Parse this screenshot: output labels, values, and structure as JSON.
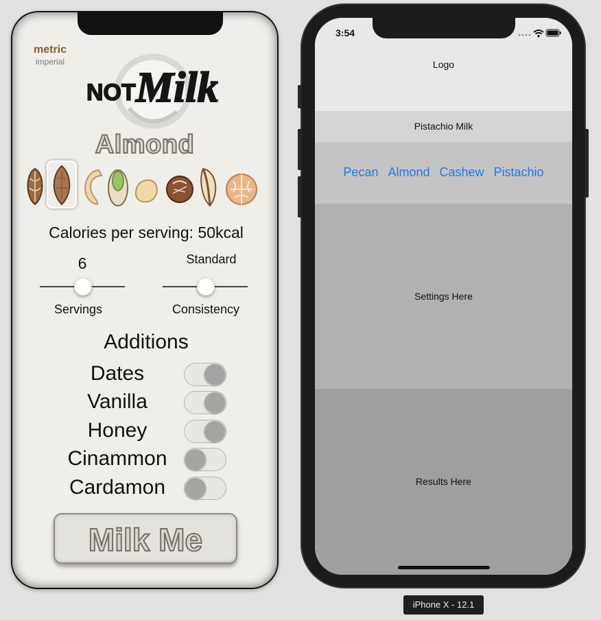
{
  "left_app": {
    "units": {
      "selected": "metric",
      "other": "imperial"
    },
    "brand": {
      "logo_alt": "NotMilk",
      "logo_text_part1": "NOT",
      "logo_text_part2": "Milk"
    },
    "selected_nut": "Almond",
    "nut_icons": [
      "pecan-icon",
      "almond-icon",
      "cashew-icon",
      "pistachio-icon",
      "macadamia-icon",
      "hazelnut-icon",
      "brazil-nut-icon",
      "walnut-icon"
    ],
    "calories_text": "Calories per serving: 50kcal",
    "servings": {
      "value": "6",
      "label": "Servings",
      "level": 0.5
    },
    "consistency": {
      "value": "Standard",
      "label": "Consistency",
      "level": 0.5
    },
    "additions_title": "Additions",
    "additions": [
      {
        "label": "Dates",
        "on": true
      },
      {
        "label": "Vanilla",
        "on": true
      },
      {
        "label": "Honey",
        "on": true
      },
      {
        "label": "Cinammon",
        "on": false
      },
      {
        "label": "Cardamon",
        "on": false
      }
    ],
    "action_button": "Milk Me",
    "colors": {
      "background": "#efeee8",
      "accent": "#8a5a3c"
    }
  },
  "simulator": {
    "status_time": "3:54",
    "logo_label": "Logo",
    "title": "Pistachio Milk",
    "nut_options": [
      "Pecan",
      "Almond",
      "Cashew",
      "Pistachio"
    ],
    "settings_label": "Settings Here",
    "results_label": "Results Here",
    "device_label": "iPhone X - 12.1",
    "colors": {
      "link": "#1f7ae6"
    }
  }
}
